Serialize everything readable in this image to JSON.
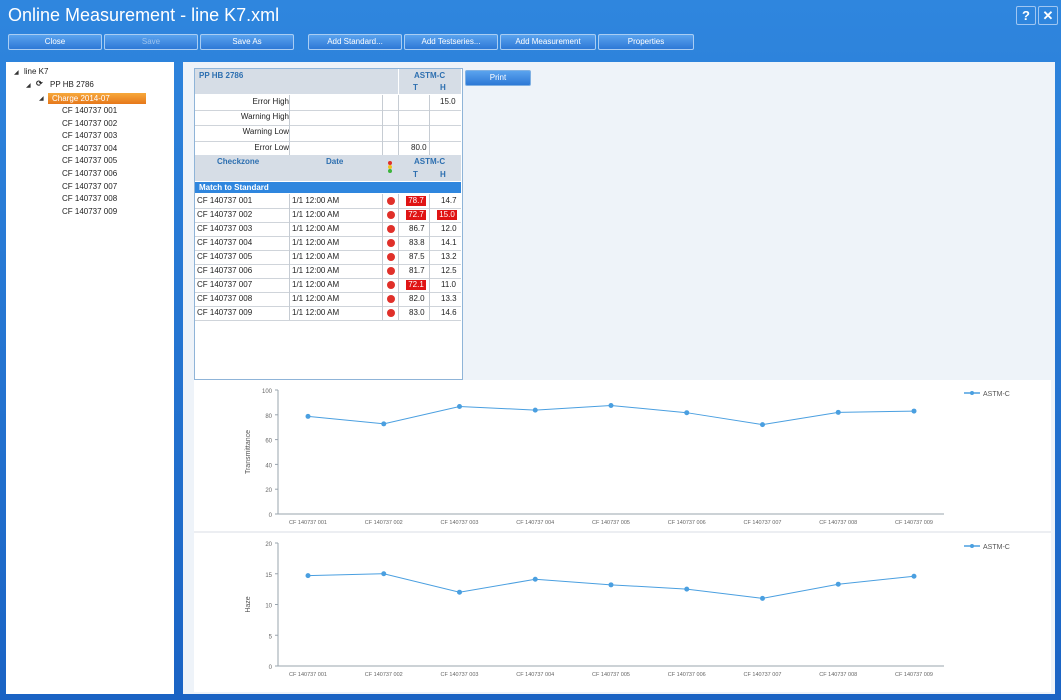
{
  "window": {
    "title": "Online Measurement - line K7.xml",
    "help_label": "?",
    "close_label": "✕"
  },
  "toolbar": {
    "close": "Close",
    "save": "Save",
    "save_as": "Save As",
    "add_standard": "Add Standard...",
    "add_testseries": "Add Testseries...",
    "add_measurement": "Add Measurement",
    "properties": "Properties"
  },
  "tree": {
    "root": "line K7",
    "standard": "PP HB 2786",
    "charge": "Charge 2014-07",
    "items": [
      "CF 140737 001",
      "CF 140737 002",
      "CF 140737 003",
      "CF 140737 004",
      "CF 140737 005",
      "CF 140737 006",
      "CF 140737 007",
      "CF 140737 008",
      "CF 140737 009"
    ]
  },
  "grid": {
    "standard": "PP HB 2786",
    "method": "ASTM-C",
    "col_t": "T",
    "col_h": "H",
    "limits": [
      {
        "label": "Error High",
        "t": "",
        "h": "15.0"
      },
      {
        "label": "Warning High",
        "t": "",
        "h": ""
      },
      {
        "label": "Warning Low",
        "t": "",
        "h": ""
      },
      {
        "label": "Error Low",
        "t": "80.0",
        "h": ""
      }
    ],
    "col_checkzone": "Checkzone",
    "col_date": "Date",
    "group": "Match to Standard",
    "rows": [
      {
        "zone": "CF 140737 001",
        "date": "1/1 12:00 AM",
        "t": "78.7",
        "h": "14.7",
        "t_bad": true,
        "h_bad": false
      },
      {
        "zone": "CF 140737 002",
        "date": "1/1 12:00 AM",
        "t": "72.7",
        "h": "15.0",
        "t_bad": true,
        "h_bad": true
      },
      {
        "zone": "CF 140737 003",
        "date": "1/1 12:00 AM",
        "t": "86.7",
        "h": "12.0",
        "t_bad": false,
        "h_bad": false
      },
      {
        "zone": "CF 140737 004",
        "date": "1/1 12:00 AM",
        "t": "83.8",
        "h": "14.1",
        "t_bad": false,
        "h_bad": false
      },
      {
        "zone": "CF 140737 005",
        "date": "1/1 12:00 AM",
        "t": "87.5",
        "h": "13.2",
        "t_bad": false,
        "h_bad": false
      },
      {
        "zone": "CF 140737 006",
        "date": "1/1 12:00 AM",
        "t": "81.7",
        "h": "12.5",
        "t_bad": false,
        "h_bad": false
      },
      {
        "zone": "CF 140737 007",
        "date": "1/1 12:00 AM",
        "t": "72.1",
        "h": "11.0",
        "t_bad": true,
        "h_bad": false
      },
      {
        "zone": "CF 140737 008",
        "date": "1/1 12:00 AM",
        "t": "82.0",
        "h": "13.3",
        "t_bad": false,
        "h_bad": false
      },
      {
        "zone": "CF 140737 009",
        "date": "1/1 12:00 AM",
        "t": "83.0",
        "h": "14.6",
        "t_bad": false,
        "h_bad": false
      }
    ]
  },
  "print_label": "Print",
  "colors": {
    "accent": "#2f86de",
    "line": "#4a9fe0",
    "error": "#e01414",
    "selection": "#f39a2e"
  },
  "chart_data": [
    {
      "type": "line",
      "categories": [
        "CF 140737 001",
        "CF 140737 002",
        "CF 140737 003",
        "CF 140737 004",
        "CF 140737 005",
        "CF 140737 006",
        "CF 140737 007",
        "CF 140737 008",
        "CF 140737 009"
      ],
      "series": [
        {
          "name": "ASTM-C",
          "values": [
            78.7,
            72.7,
            86.7,
            83.8,
            87.5,
            81.7,
            72.1,
            82.0,
            83.0
          ]
        }
      ],
      "ylabel": "Transmittance",
      "ylim": [
        0,
        100
      ],
      "yticks": [
        0,
        20,
        40,
        60,
        80,
        100
      ],
      "legend": "top-right",
      "grid": false
    },
    {
      "type": "line",
      "categories": [
        "CF 140737 001",
        "CF 140737 002",
        "CF 140737 003",
        "CF 140737 004",
        "CF 140737 005",
        "CF 140737 006",
        "CF 140737 007",
        "CF 140737 008",
        "CF 140737 009"
      ],
      "series": [
        {
          "name": "ASTM-C",
          "values": [
            14.7,
            15.0,
            12.0,
            14.1,
            13.2,
            12.5,
            11.0,
            13.3,
            14.6
          ]
        }
      ],
      "ylabel": "Haze",
      "ylim": [
        0,
        20
      ],
      "yticks": [
        0,
        5,
        10,
        15,
        20
      ],
      "legend": "top-right",
      "grid": false
    }
  ]
}
